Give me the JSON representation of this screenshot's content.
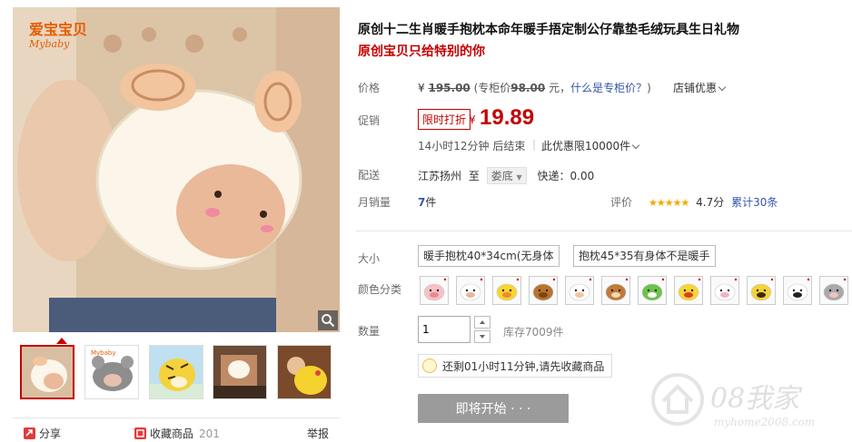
{
  "product": {
    "title": "原创十二生肖暖手抱枕本命年暖手捂定制公仔靠垫毛绒玩具生日礼物",
    "subtitle": "原创宝贝只给特别的你"
  },
  "gallery": {
    "logo_text": "Mybaby",
    "thumbnails": [
      "sheep",
      "mouse",
      "tiger",
      "cushion",
      "chick"
    ]
  },
  "share": {
    "share_label": "分享",
    "favorite_label": "收藏商品",
    "favorite_count": "201",
    "report_label": "举报"
  },
  "price": {
    "price_label": "价格",
    "currency": "¥",
    "original_price": "195.00",
    "counter_prefix": "(专柜价",
    "counter_price": "98.00",
    "counter_suffix": "元，",
    "counter_link": "什么是专柜价？",
    "counter_close": ")",
    "shop_discount": "店铺优惠",
    "promo_label": "促销",
    "promo_tag": "限时打折",
    "promo_price": "19.89",
    "countdown": "14小时12分钟 后结束",
    "limit_text": "此优惠限10000件",
    "delivery_label": "配送",
    "from": "江苏扬州",
    "to_word": "至",
    "to_city": "娄底",
    "shipping": "快递：0.00",
    "sales_label": "月销量",
    "sales_count": "7",
    "sales_unit": "件",
    "rating_label": "评价",
    "rating_stars": "★★★★★",
    "rating_score": "4.7分",
    "review_count": "累计30条"
  },
  "sku": {
    "size_label": "大小",
    "size_options": [
      "暖手抱枕40*34cm(无身体",
      "抱枕45*35有身体不是暖手"
    ],
    "color_label": "颜色分类",
    "swatches": [
      "pig",
      "rabbit",
      "chick",
      "ox",
      "sheep",
      "cow",
      "frog",
      "rooster",
      "bunny",
      "tiger",
      "dairy-cow",
      "mouse"
    ],
    "qty_label": "数量",
    "qty_value": "1",
    "stock": "库存7009件",
    "notice": "还剩01小时11分钟,请先收藏商品",
    "buy_label": "即将开始 · · ·"
  },
  "watermark": {
    "big": "08我家",
    "url": "myhome2008.com"
  },
  "colors": {
    "accent_red": "#c40000",
    "link_blue": "#3355aa",
    "button_gray": "#9b9b9b"
  }
}
